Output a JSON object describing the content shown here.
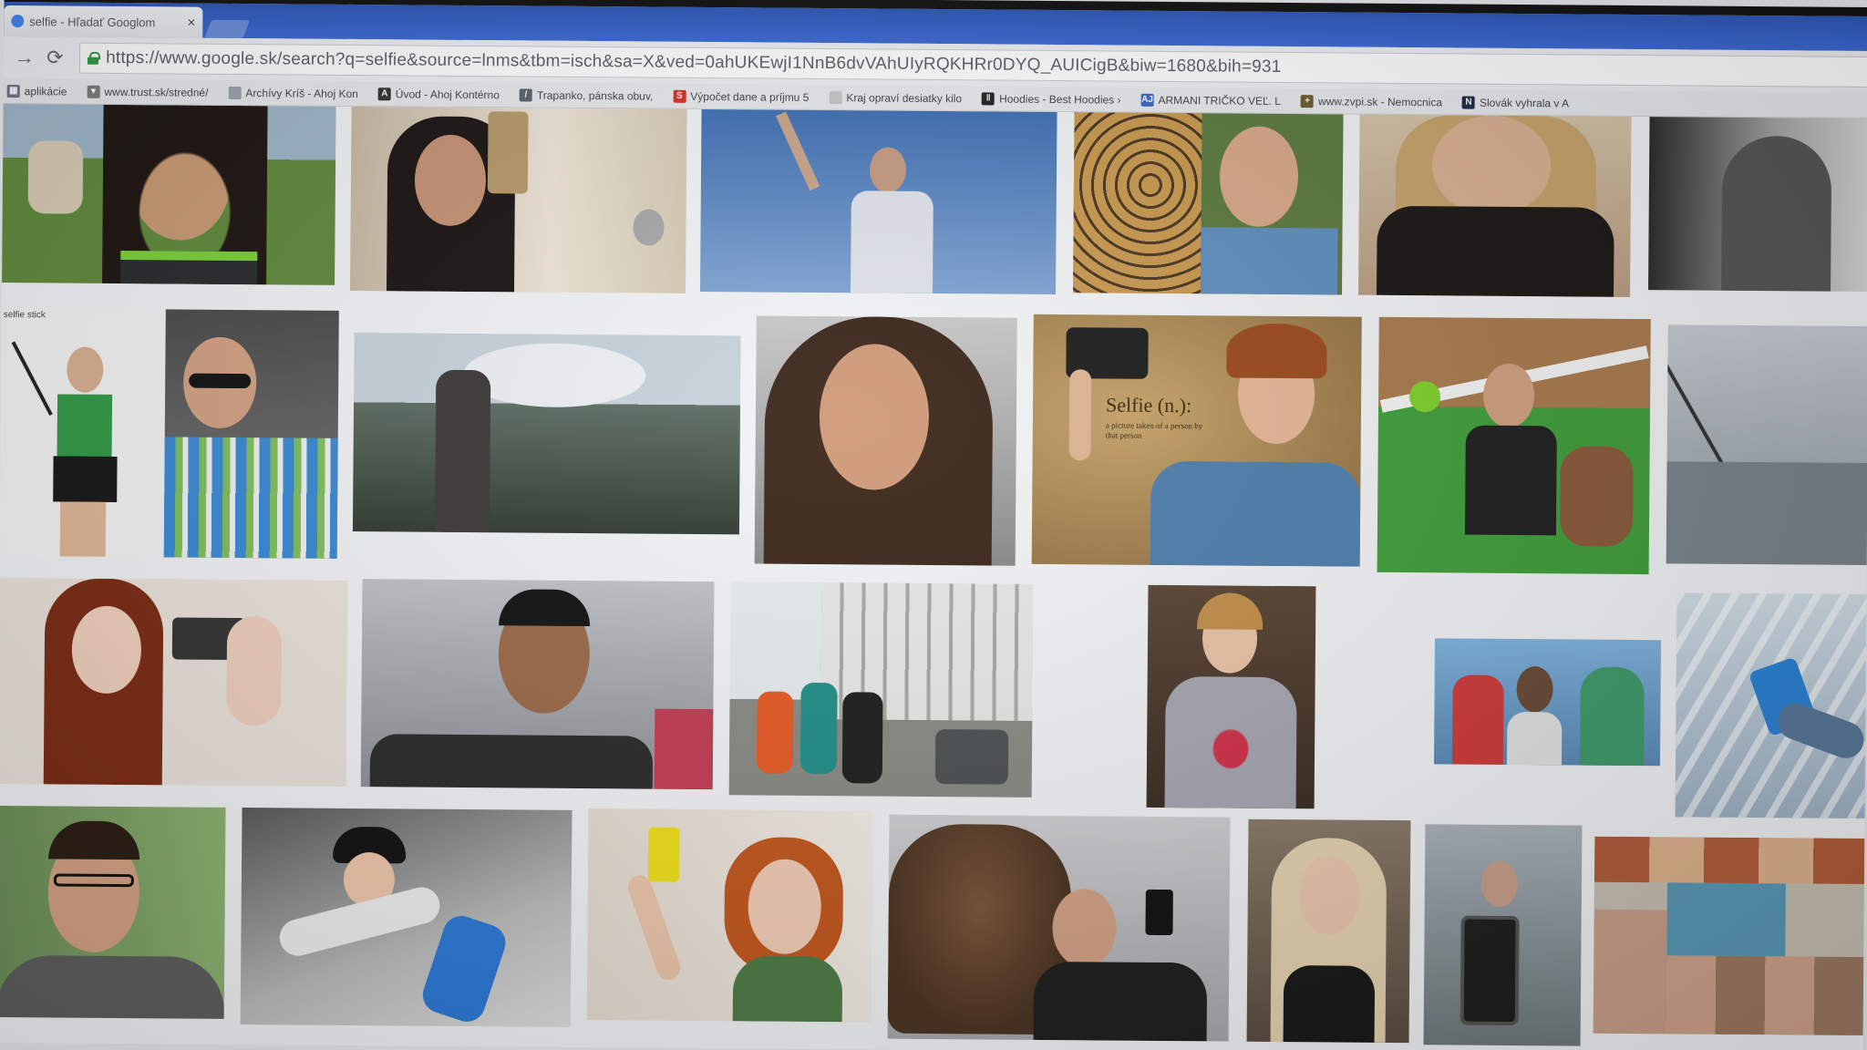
{
  "tab": {
    "title": "selfie - Hľadať Googlom",
    "close": "×"
  },
  "toolbar": {
    "back": "→",
    "reload": "⟳"
  },
  "address_bar": {
    "url": "https://www.google.sk/search?q=selfie&source=lnms&tbm=isch&sa=X&ved=0ahUKEwjI1NnB6dvVAhUIyRQKHRr0DYQ_AUICigB&biw=1680&bih=931"
  },
  "bookmarks": [
    {
      "label": "aplikácie",
      "icon": "grid-icon",
      "color": "#6b7280"
    },
    {
      "label": "www.trust.sk/stredné/",
      "icon": "pin-icon",
      "color": "#7a7a7a"
    },
    {
      "label": "Archívy Kríš - Ahoj Kon",
      "icon": "page-icon",
      "color": "#9aa3ad"
    },
    {
      "label": "Úvod - Ahoj Kontérno",
      "icon": "a-icon",
      "color": "#333333"
    },
    {
      "label": "Trapanko, pánska obuv,",
      "icon": "pen-icon",
      "color": "#5a6170"
    },
    {
      "label": "Výpočet dane a príjmu 5",
      "icon": "s-icon",
      "color": "#d93025"
    },
    {
      "label": "Kraj opraví desiatky kilo",
      "icon": "news-icon",
      "color": "#c7c7c7"
    },
    {
      "label": "Hoodies - Best Hoodies ›",
      "icon": "bars-icon",
      "color": "#222222"
    },
    {
      "label": "ARMANI TRIČKO VEĽ. L",
      "icon": "aj-icon",
      "color": "#3b66c4"
    },
    {
      "label": "www.zvpi.sk - Nemocnica",
      "icon": "cross-icon",
      "color": "#6d5a2a"
    },
    {
      "label": "Slovák vyhrala v A",
      "icon": "n-icon",
      "color": "#1f2a44"
    }
  ],
  "results": {
    "selfie_caption_title": "Selfie (n.):",
    "selfie_caption_text": "a picture taken of a person by that person",
    "tile_label": "selfie stick"
  },
  "colors": {
    "chrome_blue": "#3b6ad6",
    "secure_green": "#2e9b3f",
    "page_bg": "#f3f4f6"
  }
}
